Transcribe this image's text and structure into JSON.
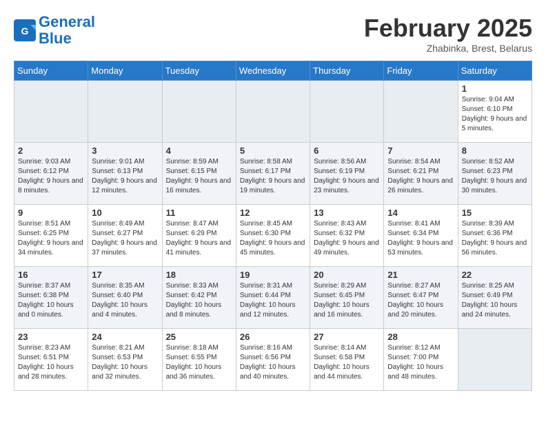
{
  "header": {
    "logo_line1": "General",
    "logo_line2": "Blue",
    "month": "February 2025",
    "location": "Zhabinka, Brest, Belarus"
  },
  "weekdays": [
    "Sunday",
    "Monday",
    "Tuesday",
    "Wednesday",
    "Thursday",
    "Friday",
    "Saturday"
  ],
  "weeks": [
    [
      {
        "day": "",
        "info": ""
      },
      {
        "day": "",
        "info": ""
      },
      {
        "day": "",
        "info": ""
      },
      {
        "day": "",
        "info": ""
      },
      {
        "day": "",
        "info": ""
      },
      {
        "day": "",
        "info": ""
      },
      {
        "day": "1",
        "info": "Sunrise: 9:04 AM\nSunset: 6:10 PM\nDaylight: 9 hours and 5 minutes."
      }
    ],
    [
      {
        "day": "2",
        "info": "Sunrise: 9:03 AM\nSunset: 6:12 PM\nDaylight: 9 hours and 8 minutes."
      },
      {
        "day": "3",
        "info": "Sunrise: 9:01 AM\nSunset: 6:13 PM\nDaylight: 9 hours and 12 minutes."
      },
      {
        "day": "4",
        "info": "Sunrise: 8:59 AM\nSunset: 6:15 PM\nDaylight: 9 hours and 16 minutes."
      },
      {
        "day": "5",
        "info": "Sunrise: 8:58 AM\nSunset: 6:17 PM\nDaylight: 9 hours and 19 minutes."
      },
      {
        "day": "6",
        "info": "Sunrise: 8:56 AM\nSunset: 6:19 PM\nDaylight: 9 hours and 23 minutes."
      },
      {
        "day": "7",
        "info": "Sunrise: 8:54 AM\nSunset: 6:21 PM\nDaylight: 9 hours and 26 minutes."
      },
      {
        "day": "8",
        "info": "Sunrise: 8:52 AM\nSunset: 6:23 PM\nDaylight: 9 hours and 30 minutes."
      }
    ],
    [
      {
        "day": "9",
        "info": "Sunrise: 8:51 AM\nSunset: 6:25 PM\nDaylight: 9 hours and 34 minutes."
      },
      {
        "day": "10",
        "info": "Sunrise: 8:49 AM\nSunset: 6:27 PM\nDaylight: 9 hours and 37 minutes."
      },
      {
        "day": "11",
        "info": "Sunrise: 8:47 AM\nSunset: 6:29 PM\nDaylight: 9 hours and 41 minutes."
      },
      {
        "day": "12",
        "info": "Sunrise: 8:45 AM\nSunset: 6:30 PM\nDaylight: 9 hours and 45 minutes."
      },
      {
        "day": "13",
        "info": "Sunrise: 8:43 AM\nSunset: 6:32 PM\nDaylight: 9 hours and 49 minutes."
      },
      {
        "day": "14",
        "info": "Sunrise: 8:41 AM\nSunset: 6:34 PM\nDaylight: 9 hours and 53 minutes."
      },
      {
        "day": "15",
        "info": "Sunrise: 8:39 AM\nSunset: 6:36 PM\nDaylight: 9 hours and 56 minutes."
      }
    ],
    [
      {
        "day": "16",
        "info": "Sunrise: 8:37 AM\nSunset: 6:38 PM\nDaylight: 10 hours and 0 minutes."
      },
      {
        "day": "17",
        "info": "Sunrise: 8:35 AM\nSunset: 6:40 PM\nDaylight: 10 hours and 4 minutes."
      },
      {
        "day": "18",
        "info": "Sunrise: 8:33 AM\nSunset: 6:42 PM\nDaylight: 10 hours and 8 minutes."
      },
      {
        "day": "19",
        "info": "Sunrise: 8:31 AM\nSunset: 6:44 PM\nDaylight: 10 hours and 12 minutes."
      },
      {
        "day": "20",
        "info": "Sunrise: 8:29 AM\nSunset: 6:45 PM\nDaylight: 10 hours and 16 minutes."
      },
      {
        "day": "21",
        "info": "Sunrise: 8:27 AM\nSunset: 6:47 PM\nDaylight: 10 hours and 20 minutes."
      },
      {
        "day": "22",
        "info": "Sunrise: 8:25 AM\nSunset: 6:49 PM\nDaylight: 10 hours and 24 minutes."
      }
    ],
    [
      {
        "day": "23",
        "info": "Sunrise: 8:23 AM\nSunset: 6:51 PM\nDaylight: 10 hours and 28 minutes."
      },
      {
        "day": "24",
        "info": "Sunrise: 8:21 AM\nSunset: 6:53 PM\nDaylight: 10 hours and 32 minutes."
      },
      {
        "day": "25",
        "info": "Sunrise: 8:18 AM\nSunset: 6:55 PM\nDaylight: 10 hours and 36 minutes."
      },
      {
        "day": "26",
        "info": "Sunrise: 8:16 AM\nSunset: 6:56 PM\nDaylight: 10 hours and 40 minutes."
      },
      {
        "day": "27",
        "info": "Sunrise: 8:14 AM\nSunset: 6:58 PM\nDaylight: 10 hours and 44 minutes."
      },
      {
        "day": "28",
        "info": "Sunrise: 8:12 AM\nSunset: 7:00 PM\nDaylight: 10 hours and 48 minutes."
      },
      {
        "day": "",
        "info": ""
      }
    ]
  ]
}
